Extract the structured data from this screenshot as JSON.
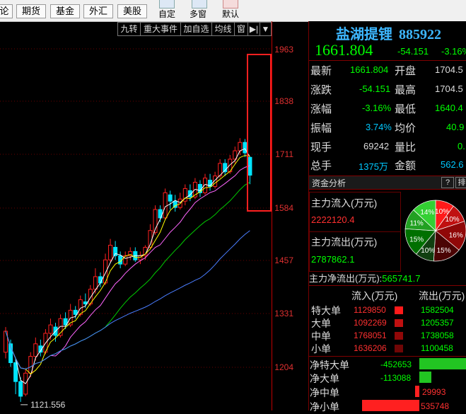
{
  "toolbar": {
    "buttons": [
      "论",
      "期货",
      "基金",
      "外汇",
      "美股"
    ],
    "labels": [
      "自定",
      "多窗",
      "默认"
    ]
  },
  "chart_tools": {
    "items": [
      "九转",
      "重大事件",
      "加自选",
      "均线",
      "窗"
    ]
  },
  "chart_data": {
    "type": "candlestick",
    "y_ticks": [
      "1963",
      "1838",
      "1711",
      "1584",
      "1457",
      "1331",
      "1204"
    ],
    "low_annotation": "1121.556",
    "ylim": [
      1121.556,
      1963
    ],
    "bullish_color": "#ff2020",
    "bearish_color": "#00e5ff",
    "ma_colors": [
      "#ffffff",
      "#ffff00",
      "#ff66ff",
      "#00cc00",
      "#4a7dff"
    ]
  },
  "stock": {
    "name": "盐湖提锂",
    "code": "885922",
    "price": "1661.804",
    "change": "-54.151",
    "change_pct": "-3.16%"
  },
  "quote": {
    "latest_label": "最新",
    "latest": "1661.804",
    "open_label": "开盘",
    "open": "1704.5",
    "change_label": "涨跌",
    "change": "-54.151",
    "high_label": "最高",
    "high": "1704.5",
    "pct_label": "涨幅",
    "pct": "-3.16%",
    "low_label": "最低",
    "low": "1640.4",
    "amp_label": "振幅",
    "amp": "3.74%",
    "avg_label": "均价",
    "avg": "40.9",
    "now_vol_label": "现手",
    "now_vol": "69242",
    "vol_ratio_label": "量比",
    "vol_ratio": "0.",
    "total_label": "总手",
    "total": "1375万",
    "amount_label": "金额",
    "amount": "562.6"
  },
  "capital": {
    "section": "资金分析",
    "btn_help": "?",
    "btn_rank": "排",
    "in_label": "主力流入(万元)",
    "in_value": "2222120.4",
    "out_label": "主力流出(万元)",
    "out_value": "2787862.1",
    "net_label": "主力净流出(万元):",
    "net_value": "565741.7",
    "pie_labels": [
      "10%",
      "10%",
      "16%",
      "15%",
      "10%",
      "15%",
      "11%",
      "14%"
    ]
  },
  "flow_table": {
    "col_in": "流入(万元)",
    "col_out": "流出(万元)",
    "rows": [
      {
        "label": "特大单",
        "in": "1129850",
        "out": "1582504"
      },
      {
        "label": "大单",
        "in": "1092269",
        "out": "1205357"
      },
      {
        "label": "中单",
        "in": "1768051",
        "out": "1738058"
      },
      {
        "label": "小单",
        "in": "1636206",
        "out": "1100458"
      }
    ],
    "net": [
      {
        "label": "净特大单",
        "value": "-452653"
      },
      {
        "label": "净大单",
        "value": "-113088"
      },
      {
        "label": "净中单",
        "value": "29993"
      },
      {
        "label": "净小单",
        "value": "535748"
      }
    ]
  }
}
